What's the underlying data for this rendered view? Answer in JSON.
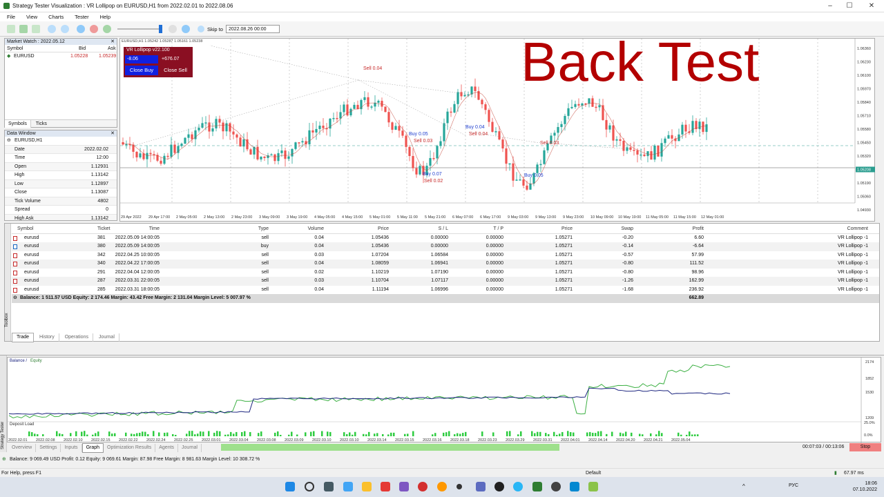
{
  "window": {
    "title": "Strategy Tester Visualization : VR Lollipop on EURUSD,H1 from 2022.02.01 to 2022.08.06"
  },
  "menu": [
    "File",
    "View",
    "Charts",
    "Tester",
    "Help"
  ],
  "toolbar": {
    "skip_label": "Skip to",
    "skip_date": "2022.08.26 00:00"
  },
  "market_watch": {
    "title": "Market Watch : 2022.05.12",
    "cols": [
      "Symbol",
      "Bid",
      "Ask"
    ],
    "rows": [
      {
        "symbol": "EURUSD",
        "bid": "1.05228",
        "ask": "1.05239"
      }
    ],
    "tabs": [
      "Symbols",
      "Ticks"
    ]
  },
  "data_window": {
    "title": "Data Window",
    "symbol": "EURUSD,H1",
    "rows": [
      {
        "k": "Date",
        "v": "2022.02.02"
      },
      {
        "k": "Time",
        "v": "12:00"
      },
      {
        "k": "Open",
        "v": "1.12931"
      },
      {
        "k": "High",
        "v": "1.13142"
      },
      {
        "k": "Low",
        "v": "1.12897"
      },
      {
        "k": "Close",
        "v": "1.13087"
      },
      {
        "k": "Tick Volume",
        "v": "4802"
      },
      {
        "k": "Spread",
        "v": "0"
      },
      {
        "k": "High Ask",
        "v": "1.13142"
      }
    ]
  },
  "chart": {
    "header": "EURUSD,H1  1.05242 1.05287 1.05161 1.05238",
    "overlay_title": "Back Test",
    "vr": {
      "title": "VR Lollipop v22.100",
      "pnl_buy": "-8.06",
      "pnl_sell": "+676.07",
      "close_buy": "Close Buy",
      "close_sell": "Close Sell"
    },
    "price_labels": [
      "1.06360",
      "1.06230",
      "1.06100",
      "1.05970",
      "1.05840",
      "1.05710",
      "1.05580",
      "1.05450",
      "1.05320",
      "1.05208",
      "1.05190",
      "1.05060",
      "1.04930"
    ],
    "time_labels": [
      "29 Apr 2022",
      "29 Apr 17:00",
      "2 May 05:00",
      "2 May 13:00",
      "2 May 23:00",
      "3 May 09:00",
      "3 May 19:00",
      "4 May 05:00",
      "4 May 15:00",
      "5 May 01:00",
      "5 May 11:00",
      "5 May 21:00",
      "6 May 07:00",
      "6 May 17:00",
      "9 May 03:00",
      "9 May 13:00",
      "9 May 23:00",
      "10 May 09:00",
      "10 May 19:00",
      "11 May 05:00",
      "11 May 15:00",
      "12 May 01:00"
    ],
    "trade_labels": [
      "Sell 0.04",
      "Buy 0.05",
      "Sell 0.03",
      "Buy 0.07",
      "Sell 0.02",
      "Buy 0.04",
      "Sell 0.04",
      "Buy 0.05",
      "Sell 0.03"
    ],
    "colors": {
      "bull": "#26a69a",
      "bear": "#ef5350",
      "title": "#b30000"
    }
  },
  "trades": {
    "cols": [
      "Symbol",
      "Ticket",
      "Time",
      "Type",
      "Volume",
      "Price",
      "S / L",
      "T / P",
      "Price",
      "Swap",
      "Profit",
      "Comment"
    ],
    "rows": [
      {
        "symbol": "eurusd",
        "ticket": "381",
        "time": "2022.05.09 14:00:05",
        "type": "sell",
        "volume": "0.04",
        "price": "1.05436",
        "sl": "0.00000",
        "tp": "0.00000",
        "cur": "1.05271",
        "swap": "-0.20",
        "profit": "6.60",
        "comment": "VR Lollipop -1"
      },
      {
        "symbol": "eurusd",
        "ticket": "380",
        "time": "2022.05.09 14:00:05",
        "type": "buy",
        "volume": "0.04",
        "price": "1.05436",
        "sl": "0.00000",
        "tp": "0.00000",
        "cur": "1.05271",
        "swap": "-0.14",
        "profit": "-6.64",
        "comment": "VR Lollipop -1"
      },
      {
        "symbol": "eurusd",
        "ticket": "342",
        "time": "2022.04.25 10:00:05",
        "type": "sell",
        "volume": "0.03",
        "price": "1.07204",
        "sl": "1.06584",
        "tp": "0.00000",
        "cur": "1.05271",
        "swap": "-0.57",
        "profit": "57.99",
        "comment": "VR Lollipop -1"
      },
      {
        "symbol": "eurusd",
        "ticket": "340",
        "time": "2022.04.22 17:00:05",
        "type": "sell",
        "volume": "0.04",
        "price": "1.08059",
        "sl": "1.06941",
        "tp": "0.00000",
        "cur": "1.05271",
        "swap": "-0.80",
        "profit": "111.52",
        "comment": "VR Lollipop -1"
      },
      {
        "symbol": "eurusd",
        "ticket": "291",
        "time": "2022.04.04 12:00:05",
        "type": "sell",
        "volume": "0.02",
        "price": "1.10219",
        "sl": "1.07190",
        "tp": "0.00000",
        "cur": "1.05271",
        "swap": "-0.80",
        "profit": "98.96",
        "comment": "VR Lollipop -1"
      },
      {
        "symbol": "eurusd",
        "ticket": "287",
        "time": "2022.03.31 22:00:05",
        "type": "sell",
        "volume": "0.03",
        "price": "1.10704",
        "sl": "1.07117",
        "tp": "0.00000",
        "cur": "1.05271",
        "swap": "-1.26",
        "profit": "162.99",
        "comment": "VR Lollipop -1"
      },
      {
        "symbol": "eurusd",
        "ticket": "285",
        "time": "2022.03.31 18:00:05",
        "type": "sell",
        "volume": "0.04",
        "price": "1.11194",
        "sl": "1.06996",
        "tp": "0.00000",
        "cur": "1.05271",
        "swap": "-1.68",
        "profit": "236.92",
        "comment": "VR Lollipop -1"
      }
    ],
    "balance_line": "Balance: 1 511.57 USD  Equity: 2 174.46  Margin: 43.42  Free Margin: 2 131.04  Margin Level: 5 007.97 %",
    "total_profit": "662.89",
    "tabs": [
      "Trade",
      "History",
      "Operations",
      "Journal"
    ],
    "side_label": "Toolbox"
  },
  "tester": {
    "side_label": "Strategy Tester",
    "legend": {
      "balance": "Balance",
      "equity": "Equity"
    },
    "deposit_label": "Deposit Load",
    "y_labels": [
      "2174",
      "1852",
      "1530",
      "1209"
    ],
    "load_labels": [
      "25.0%",
      "0.0%"
    ],
    "date_labels": [
      "2022.02.01",
      "2022.02.08",
      "2022.02.10",
      "2022.02.15",
      "2022.02.22",
      "2022.02.24",
      "2022.02.25",
      "2022.03.01",
      "2022.03.04",
      "2022.03.08",
      "2022.03.09",
      "2022.03.10",
      "2022.03.10",
      "2022.03.14",
      "2022.03.15",
      "2022.03.16",
      "2022.03.18",
      "2022.03.23",
      "2022.03.29",
      "2022.03.31",
      "2022.04.01",
      "2022.04.14",
      "2022.04.20",
      "2022.04.21",
      "2022.05.04"
    ],
    "tabs": [
      "Overview",
      "Settings",
      "Inputs",
      "Graph",
      "Optimization Results",
      "Agents",
      "Journal"
    ],
    "elapsed": "00:07:03 / 00:13:06",
    "stop": "Stop",
    "progress": 0.55,
    "status": "Balance: 9 069.49 USD  Profit: 0.12  Equity: 9 069.61  Margin: 87.98  Free Margin: 8 981.63  Margin Level: 10 308.72 %"
  },
  "helpbar": {
    "help": "For Help, press F1",
    "profile": "Default",
    "speed": "67.97 ms"
  },
  "taskbar": {
    "lang": "РУС",
    "time": "18:06",
    "date": "07.10.2022"
  }
}
